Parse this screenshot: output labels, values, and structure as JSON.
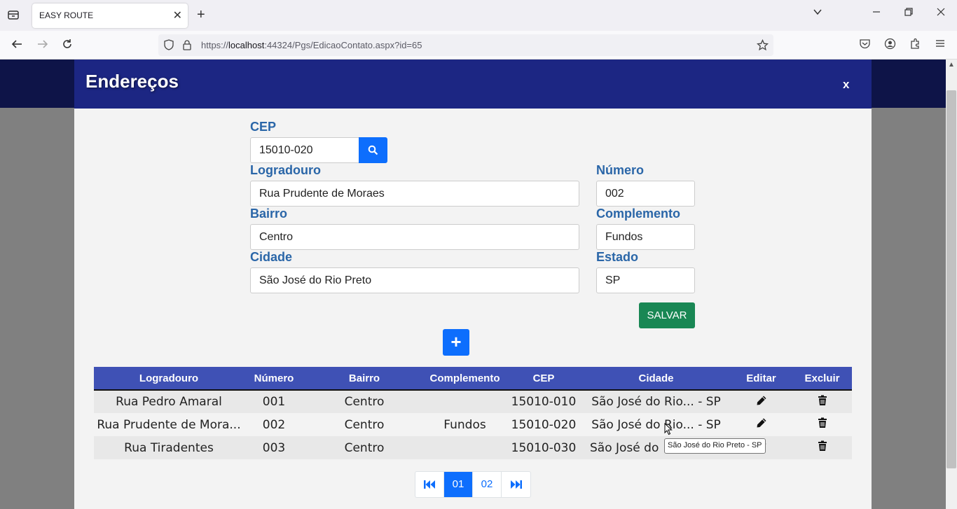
{
  "browser": {
    "tab_title": "EASY ROUTE",
    "url_prefix": "https://",
    "url_host": "localhost",
    "url_rest": ":44324/Pgs/EdicaoContato.aspx?id=65"
  },
  "modal": {
    "title": "Endereços",
    "close_label": "x"
  },
  "form": {
    "cep_label": "CEP",
    "cep_value": "15010-020",
    "logradouro_label": "Logradouro",
    "logradouro_value": "Rua Prudente de Moraes",
    "numero_label": "Número",
    "numero_value": "002",
    "bairro_label": "Bairro",
    "bairro_value": "Centro",
    "complemento_label": "Complemento",
    "complemento_value": "Fundos",
    "cidade_label": "Cidade",
    "cidade_value": "São José do Rio Preto",
    "estado_label": "Estado",
    "estado_value": "SP",
    "save_label": "SALVAR",
    "add_label": "+"
  },
  "table": {
    "headers": [
      "Logradouro",
      "Número",
      "Bairro",
      "Complemento",
      "CEP",
      "Cidade",
      "Editar",
      "Excluir"
    ],
    "rows": [
      {
        "logradouro": "Rua Pedro Amaral",
        "numero": "001",
        "bairro": "Centro",
        "complemento": "",
        "cep": "15010-010",
        "cidade": "São José do Rio... - SP"
      },
      {
        "logradouro": "Rua Prudente de Mora...",
        "numero": "002",
        "bairro": "Centro",
        "complemento": "Fundos",
        "cep": "15010-020",
        "cidade": "São José do Rio... - SP"
      },
      {
        "logradouro": "Rua Tiradentes",
        "numero": "003",
        "bairro": "Centro",
        "complemento": "",
        "cep": "15010-030",
        "cidade": "São José do"
      }
    ]
  },
  "pager": {
    "first_icon": "first-page-icon",
    "pages": [
      "01",
      "02"
    ],
    "last_icon": "last-page-icon"
  },
  "tooltip": "São José do Rio Preto - SP",
  "colors": {
    "header_dark": "#0e1448",
    "modal_header": "#1c2683",
    "table_header": "#3f51b5",
    "label_blue": "#2a66a8",
    "primary": "#0d6efd",
    "success": "#198754"
  }
}
